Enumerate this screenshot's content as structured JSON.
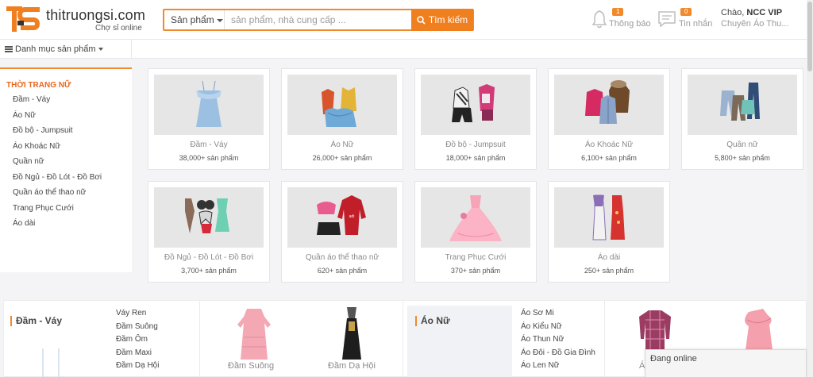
{
  "header": {
    "logo_mark": "TS",
    "logo_name": "thitruongsi.com",
    "logo_tagline": "Chợ sỉ online",
    "search_category": "Sản phẩm",
    "search_placeholder": "sản phẩm, nhà cung cấp ...",
    "search_button": "Tìm kiếm",
    "notifications_badge": "1",
    "notifications_label": "Thông báo",
    "messages_badge": "0",
    "messages_label": "Tin nhắn",
    "greeting_prefix": "Chào,",
    "greeting_name": "NCC VIP",
    "greeting_sub": "Chuyên Áo Thu...",
    "accent_color": "#f08a2c"
  },
  "category_bar": {
    "label": "Danh mục sản phẩm"
  },
  "sidebar": {
    "title": "THỜI TRANG NỮ",
    "items": [
      "Đầm - Váy",
      "Áo Nữ",
      "Đồ bộ - Jumpsuit",
      "Áo Khoác Nữ",
      "Quần nữ",
      "Đồ Ngủ - Đồ Lót - Đồ Bơi",
      "Quần áo thể thao nữ",
      "Trang Phục Cưới",
      "Áo dài"
    ]
  },
  "categories": [
    {
      "name": "Đầm - Váy",
      "count": "38,000+ sản phẩm"
    },
    {
      "name": "Áo Nữ",
      "count": "26,000+ sản phẩm"
    },
    {
      "name": "Đồ bộ - Jumpsuit",
      "count": "18,000+ sản phẩm"
    },
    {
      "name": "Áo Khoác Nữ",
      "count": "6,100+ sản phẩm"
    },
    {
      "name": "Quần nữ",
      "count": "5,800+ sản phẩm"
    },
    {
      "name": "Đồ Ngủ - Đồ Lót - Đồ Bơi",
      "count": "3,700+ sản phẩm"
    },
    {
      "name": "Quần áo thể thao nữ",
      "count": "620+ sản phẩm"
    },
    {
      "name": "Trang Phục Cưới",
      "count": "370+ sản phẩm"
    },
    {
      "name": "Áo dài",
      "count": "250+ sản phẩm"
    }
  ],
  "bottom": {
    "panel1_title": "Đầm - Váy",
    "panel1_links": [
      "Váy Ren",
      "Đầm Suông",
      "Đầm Ôm",
      "Đầm Maxi",
      "Đầm Dạ Hội"
    ],
    "panel1_img1_label": "Đầm Suông",
    "panel1_img2_label": "Đầm Dạ Hội",
    "panel2_title": "Áo Nữ",
    "panel2_links": [
      "Áo Sơ Mi",
      "Áo Kiểu Nữ",
      "Áo Thun Nữ",
      "Áo Đôi - Đồ Gia Đình",
      "Áo Len Nữ"
    ],
    "panel2_img1_label": "Á..."
  },
  "chat": {
    "label": "Đang online"
  }
}
